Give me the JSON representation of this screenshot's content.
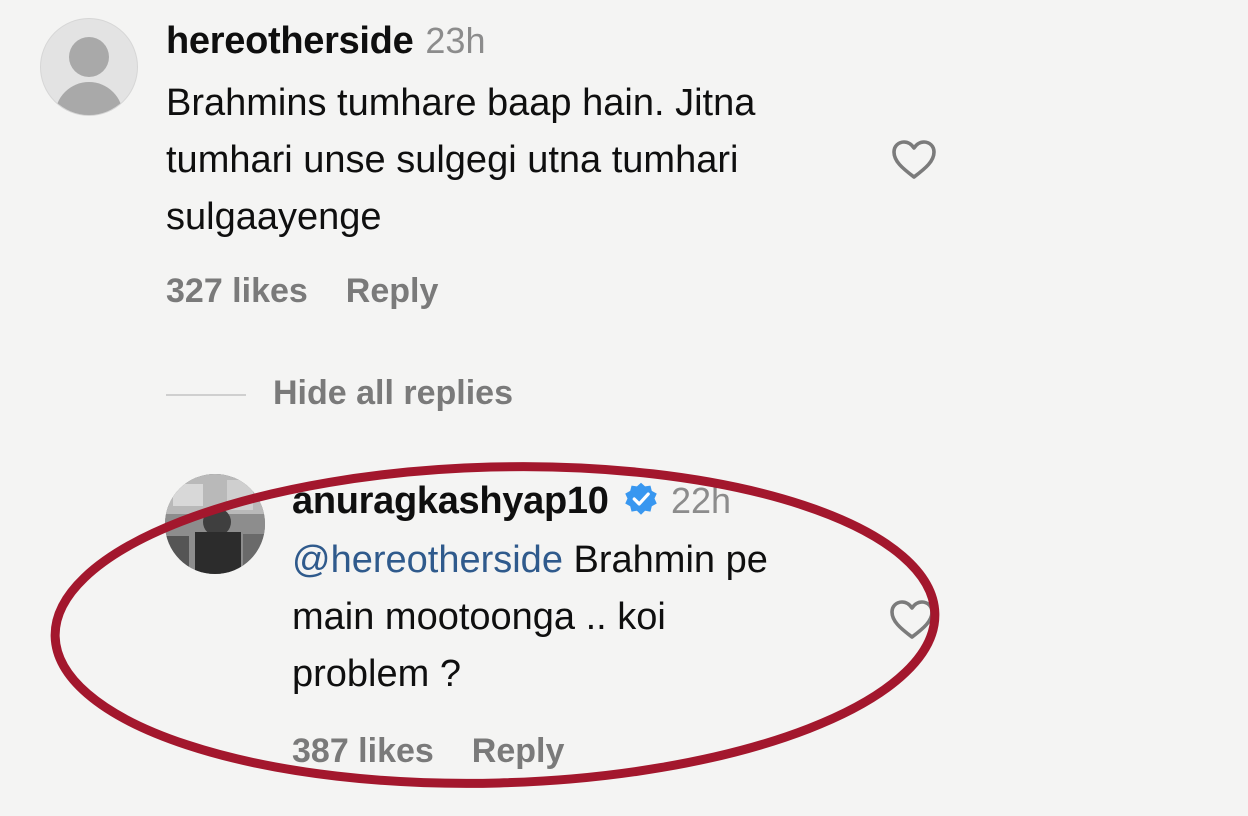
{
  "comments": [
    {
      "username": "hereotherside",
      "timestamp": "23h",
      "text_lines": [
        "Brahmins tumhare baap hain. Jitna",
        "tumhari unse sulgegi utna tumhari",
        "sulgaayenge"
      ],
      "likes": "327 likes",
      "reply_label": "Reply"
    },
    {
      "username": "anuragkashyap10",
      "timestamp": "22h",
      "mention": "@hereotherside",
      "text_lines": [
        " Brahmin pe",
        "main mootoonga .. koi",
        "problem ?"
      ],
      "likes": "387 likes",
      "reply_label": "Reply",
      "verified": true
    }
  ],
  "hide_replies_label": "Hide all replies",
  "colors": {
    "background": "#f4f4f3",
    "oval": "#a3172d",
    "verified": "#3897f0",
    "mention": "#2f5a8c"
  },
  "icons": [
    "default-avatar-icon",
    "heart-icon",
    "verified-badge-icon"
  ]
}
